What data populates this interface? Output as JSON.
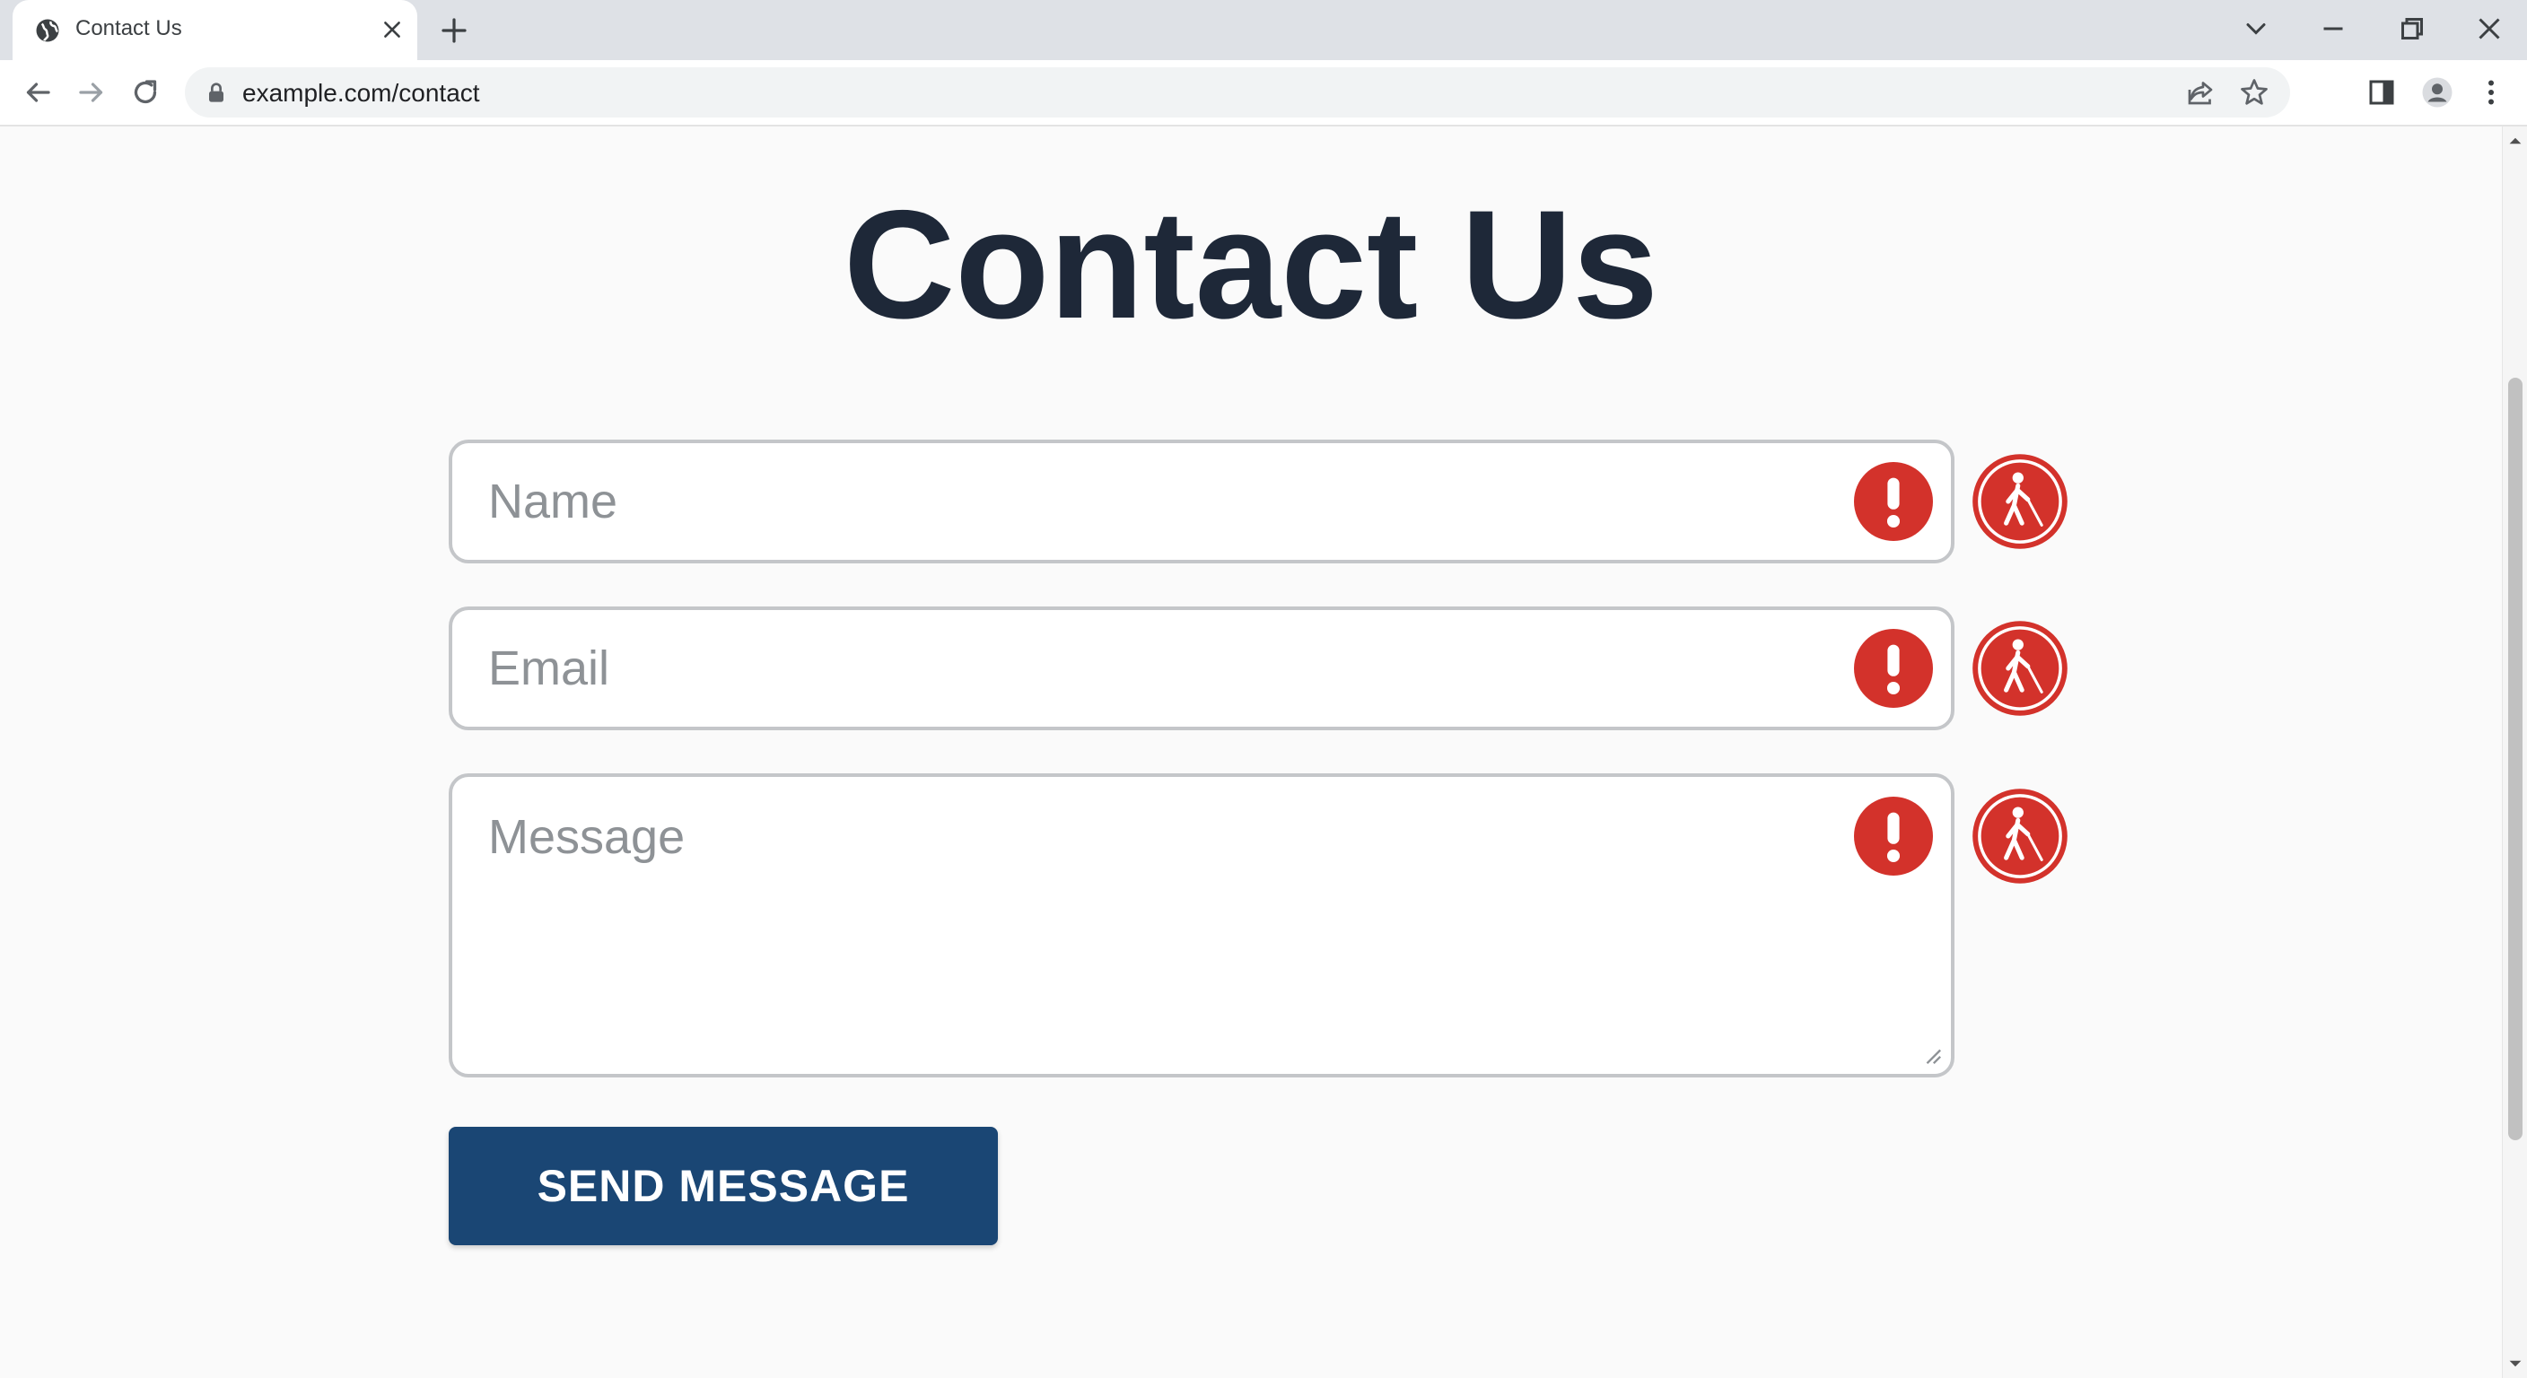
{
  "browser": {
    "tab_title": "Contact Us",
    "url": "example.com/contact"
  },
  "page": {
    "title": "Contact Us"
  },
  "form": {
    "fields": [
      {
        "placeholder": "Name",
        "value": "",
        "status": "error"
      },
      {
        "placeholder": "Email",
        "value": "",
        "status": "error"
      },
      {
        "placeholder": "Message",
        "value": "",
        "status": "error"
      }
    ],
    "submit_label": "SEND MESSAGE"
  },
  "icons": {
    "error": "exclamation-icon",
    "accessibility": "blind-person-cane-icon"
  },
  "colors": {
    "title": "#1e2838",
    "error": "#d3322b",
    "button": "#1a4674",
    "field_border": "#c4c6c9",
    "placeholder": "#8e9296"
  }
}
